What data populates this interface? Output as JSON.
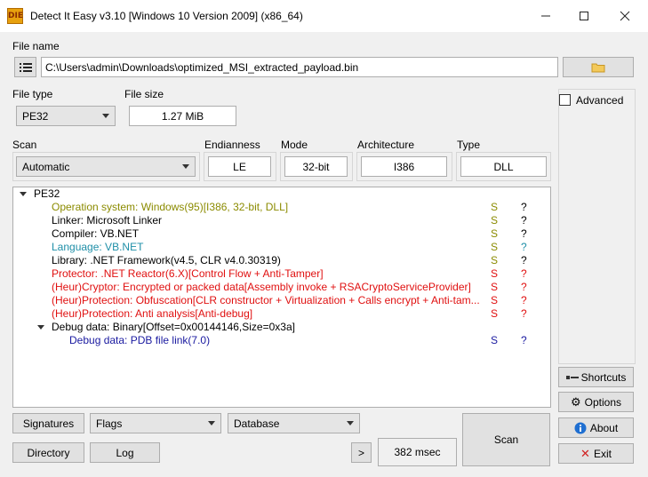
{
  "window": {
    "icon_text": "DIE",
    "title": "Detect It Easy v3.10 [Windows 10 Version 2009] (x86_64)"
  },
  "file": {
    "label": "File name",
    "path": "C:\\Users\\admin\\Downloads\\optimized_MSI_extracted_payload.bin"
  },
  "file_type": {
    "label": "File type",
    "value": "PE32"
  },
  "file_size": {
    "label": "File size",
    "value": "1.27 MiB"
  },
  "scan_mode": {
    "label": "Scan",
    "value": "Automatic"
  },
  "endianness": {
    "label": "Endianness",
    "value": "LE"
  },
  "mode": {
    "label": "Mode",
    "value": "32-bit"
  },
  "architecture": {
    "label": "Architecture",
    "value": "I386"
  },
  "type": {
    "label": "Type",
    "value": "DLL"
  },
  "advanced": {
    "label": "Advanced",
    "checked": false
  },
  "results": {
    "root": "PE32",
    "rows": [
      {
        "text": "Operation system: Windows(95)[I386, 32-bit, DLL]",
        "s": "S",
        "q": "?",
        "color": "#8b8b00"
      },
      {
        "text": "Linker: Microsoft Linker",
        "s": "S",
        "q": "?",
        "color": "#000000"
      },
      {
        "text": "Compiler: VB.NET",
        "s": "S",
        "q": "?",
        "color": "#000000"
      },
      {
        "text": "Language: VB.NET",
        "s": "S",
        "q": "?",
        "color": "#1f8fa8"
      },
      {
        "text": "Library: .NET Framework(v4.5, CLR v4.0.30319)",
        "s": "S",
        "q": "?",
        "color": "#000000"
      },
      {
        "text": "Protector: .NET Reactor(6.X)[Control Flow + Anti-Tamper]",
        "s": "S",
        "q": "?",
        "color": "#e01010"
      },
      {
        "text": "(Heur)Cryptor: Encrypted or packed data[Assembly invoke + RSACryptoServiceProvider]",
        "s": "S",
        "q": "?",
        "color": "#e01010"
      },
      {
        "text": "(Heur)Protection: Obfuscation[CLR constructor + Virtualization + Calls encrypt + Anti-tam...",
        "s": "S",
        "q": "?",
        "color": "#e01010"
      },
      {
        "text": "(Heur)Protection: Anti analysis[Anti-debug]",
        "s": "S",
        "q": "?",
        "color": "#e01010"
      }
    ],
    "debug_parent": "Debug data: Binary[Offset=0x00144146,Size=0x3a]",
    "debug_child": {
      "text": "Debug data: PDB file link(7.0)",
      "s": "S",
      "q": "?",
      "color": "#1a1aa0"
    }
  },
  "bottom": {
    "signatures": "Signatures",
    "flags": "Flags",
    "database": "Database",
    "directory": "Directory",
    "log": "Log",
    "more": ">",
    "elapsed": "382 msec",
    "scan": "Scan"
  },
  "side": {
    "shortcuts": "Shortcuts",
    "options": "Options",
    "about": "About",
    "exit": "Exit"
  },
  "colors": {
    "warning": "#e01010",
    "os": "#8b8b00",
    "language": "#1f8fa8",
    "debug": "#1a1aa0",
    "s_col": "#8b8b00",
    "q_col": "#000000"
  }
}
